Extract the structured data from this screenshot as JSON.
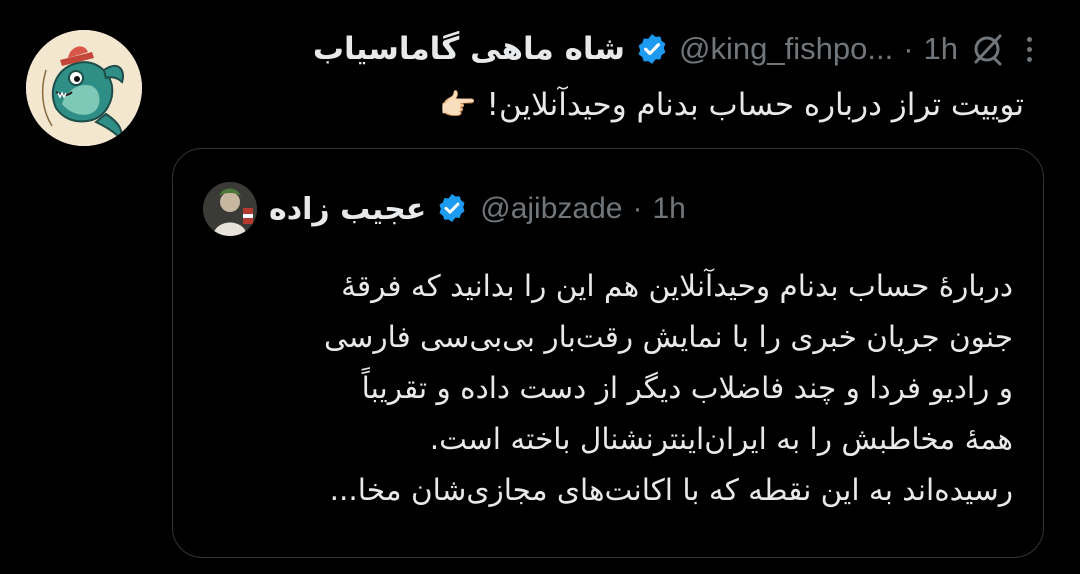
{
  "tweet": {
    "display_name": "شاه ماهی گاماسیاب",
    "handle": "@king_fishpo...",
    "separator": "·",
    "time": "1h",
    "text": "توییت تراز درباره حساب بدنام وحیدآنلاین!",
    "text_emoji": "👉🏻",
    "avatar_icon": "cartoon-fish-avatar",
    "verified_icon": "verified-badge-icon",
    "grok_icon": "grok-icon",
    "more_icon": "more-options-icon"
  },
  "quote": {
    "display_name": "عجیب زاده",
    "handle": "@ajibzade",
    "separator": "·",
    "time": "1h",
    "avatar_icon": "profile-photo-avatar",
    "verified_icon": "verified-badge-icon",
    "lines": [
      "دربارهٔ حساب بدنام وحیدآنلاین هم این را بدانید که فرقهٔ",
      "جنون جریان خبری را با نمایش رقت‌بار بی‌بی‌سی فارسی",
      "و رادیو فردا و چند فاضلاب دیگر از دست داده و تقریباً",
      "همهٔ مخاطبش را به ایران‌اینترنشنال باخته است.",
      "رسیده‌اند به این نقطه که با اکانت‌های مجازی‌شان مخا..."
    ]
  },
  "colors": {
    "background": "#000000",
    "text_primary": "#e7e9ea",
    "text_secondary": "#71767b",
    "verified_blue": "#1d9bf0",
    "border": "#2f3336"
  }
}
